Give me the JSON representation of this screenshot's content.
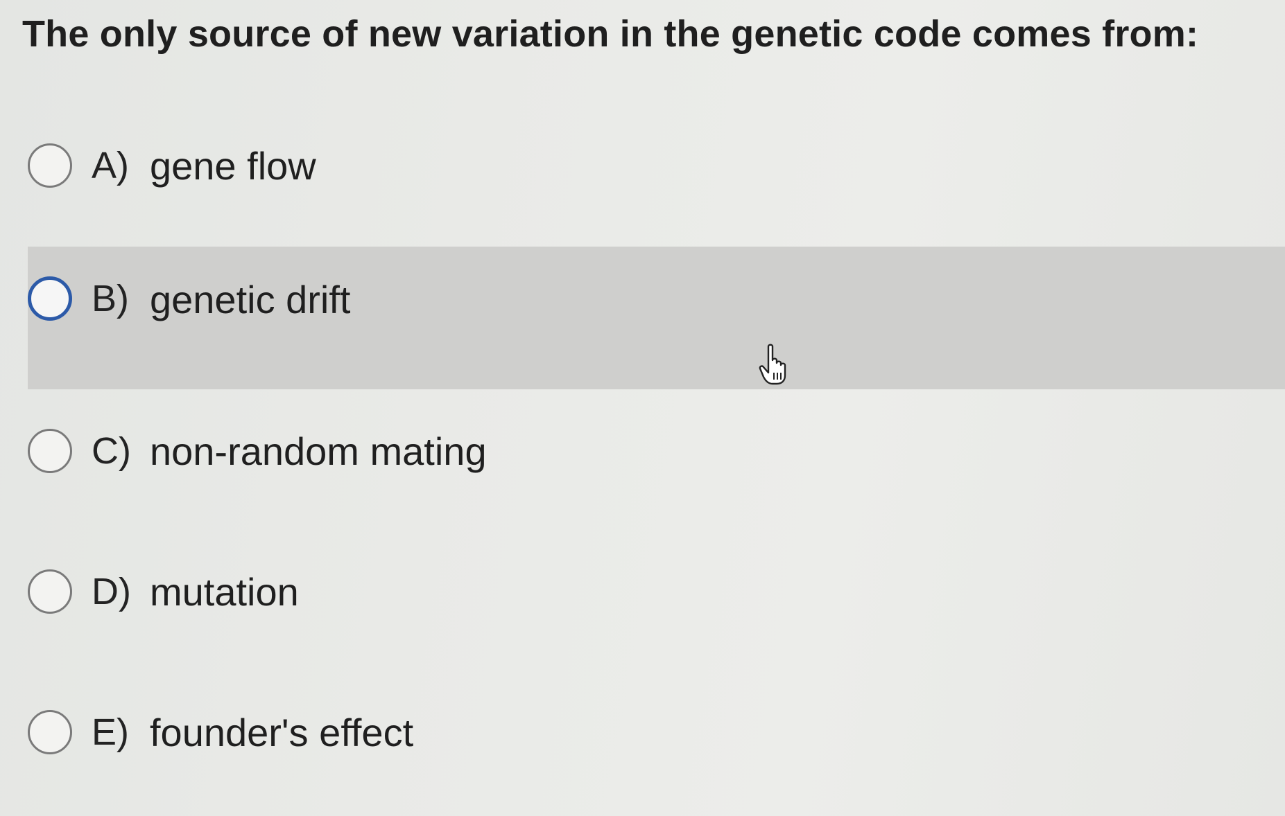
{
  "question": {
    "text": "The only source of new variation in the genetic code comes from:"
  },
  "options": [
    {
      "letter": "A)",
      "text": "gene flow",
      "hovered": false
    },
    {
      "letter": "B)",
      "text": "genetic drift",
      "hovered": true
    },
    {
      "letter": "C)",
      "text": "non-random mating",
      "hovered": false
    },
    {
      "letter": "D)",
      "text": "mutation",
      "hovered": false
    },
    {
      "letter": "E)",
      "text": "founder's effect",
      "hovered": false
    }
  ],
  "colors": {
    "hover_background": "#cfcfcd",
    "focused_radio_border": "#2c5aa8",
    "radio_border": "#7a7a7a"
  },
  "icons": {
    "cursor": "hand-pointer-icon"
  }
}
